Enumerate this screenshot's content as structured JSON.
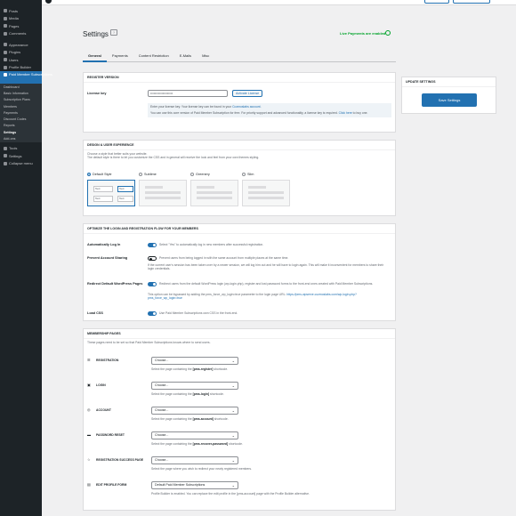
{
  "sidebar": {
    "items_top": [
      {
        "label": "Posts",
        "icon": "pin-icon"
      },
      {
        "label": "Media",
        "icon": "media-icon"
      },
      {
        "label": "Pages",
        "icon": "pages-icon"
      },
      {
        "label": "Comments",
        "icon": "comments-icon"
      }
    ],
    "items_mid": [
      {
        "label": "Appearance",
        "icon": "brush-icon"
      },
      {
        "label": "Plugins",
        "icon": "plugin-icon"
      },
      {
        "label": "Users",
        "icon": "users-icon"
      },
      {
        "label": "Profile Builder",
        "icon": "profile-icon"
      }
    ],
    "active_item": "Paid Member Subscriptions",
    "submenu": [
      "Dashboard",
      "Basic Information",
      "Subscription Plans",
      "Members",
      "Payments",
      "Discount Codes",
      "Reports",
      "Settings",
      "Add-ons"
    ],
    "current_submenu": "Settings",
    "items_bottom": [
      {
        "label": "Tools",
        "icon": "tools-icon"
      },
      {
        "label": "Settings",
        "icon": "settings-icon"
      },
      {
        "label": "Collapse menu",
        "icon": "collapse-icon"
      }
    ]
  },
  "header": {
    "title": "Settings",
    "live_status": "Live Payments are enabled"
  },
  "tabs": [
    "General",
    "Payments",
    "Content Restriction",
    "E-Mails",
    "Misc"
  ],
  "active_tab": "General",
  "register_version": {
    "heading": "Register Version",
    "license_label": "License key",
    "license_value": "••••••••••••••••••••",
    "activate_label": "Activate License",
    "info_line1_pre": "Enter your license key. Your license key can be found in your ",
    "info_line1_link": "Cozmoslabs account",
    "info_line1_post": ".",
    "info_line2_pre": "You can use this core version of Paid Member Subscription for free. For priority support and advanced functionality, a license key is required. ",
    "info_line2_link": "Click here",
    "info_line2_post": " to buy one."
  },
  "design": {
    "heading": "Design & User Experience",
    "desc1": "Choose a style that better suits your website.",
    "desc2": "The default style is there to let you customize the CSS and in general will receive the look and feel from your own themes styling.",
    "options": [
      "Default Style",
      "Sublime",
      "Greenery",
      "Slim"
    ],
    "selected": "Default Style",
    "preview_text": "Text"
  },
  "optimize": {
    "heading": "Optimize the login and registration flow for your members",
    "rows": [
      {
        "label": "Automatically Log In",
        "on": true,
        "desc": "Select \"Yes\" to automatically log in new members after successful registration."
      },
      {
        "label": "Prevent Account Sharing",
        "on": false,
        "desc": "Prevent users from being logged in with the same account from multiple places at the same time.",
        "sub": "If the current user's session has been taken over by a newer session, we will log him out and he will have to login again. This will make it inconvenient for members to share their login credentials."
      },
      {
        "label": "Redirect Default WordPress Pages",
        "on": true,
        "desc": "Redirect users from the default WordPress login (wp-login.php), register and lost password forms to the front-end ones created with Paid Member Subscriptions.",
        "sub_pre": "This option can be bypassed by adding the pms_force_wp_login=true parameter to the login page URL: ",
        "sub_link": "https://pms-wpserve.cozmoslabs.com/wp-login.php?pms_force_wp_login=true"
      },
      {
        "label": "Load CSS",
        "on": true,
        "desc": "Use Paid Member Subscriptions own CSS in the front-end."
      }
    ]
  },
  "membership_pages": {
    "heading": "Membership Pages",
    "desc": "These pages need to be set so that Paid Member Subscriptions knows where to send users.",
    "rows": [
      {
        "label": "Registration",
        "icon": "register-icon",
        "value": "Choose...",
        "desc_pre": "Select the page containing the ",
        "desc_bold": "[pms-register]",
        "desc_post": " shortcode."
      },
      {
        "label": "Login",
        "icon": "lock-icon",
        "value": "Choose...",
        "desc_pre": "Select the page containing the ",
        "desc_bold": "[pms-login]",
        "desc_post": " shortcode."
      },
      {
        "label": "Account",
        "icon": "account-icon",
        "value": "Choose...",
        "desc_pre": "Select the page containing the ",
        "desc_bold": "[pms-account]",
        "desc_post": " shortcode."
      },
      {
        "label": "Password Reset",
        "icon": "key-icon",
        "value": "Choose...",
        "desc_pre": "Select the page containing the ",
        "desc_bold": "[pms-recover-password]",
        "desc_post": " shortcode."
      },
      {
        "label": "Registration Success Page",
        "icon": "star-icon",
        "value": "Choose...",
        "desc_pre": "Select the page where you wish to redirect your newly registered members.",
        "desc_bold": "",
        "desc_post": ""
      },
      {
        "label": "Edit Profile Form",
        "icon": "edit-icon",
        "value": "Default Paid Member Subscriptions",
        "desc_pre": "Profile Builder is enabled. You can replace the edit profile in the [pms-account] page with the Profile Builder alternative.",
        "desc_bold": "",
        "desc_post": ""
      }
    ]
  },
  "update_box": {
    "heading": "Update Settings",
    "save_label": "Save Settings"
  }
}
